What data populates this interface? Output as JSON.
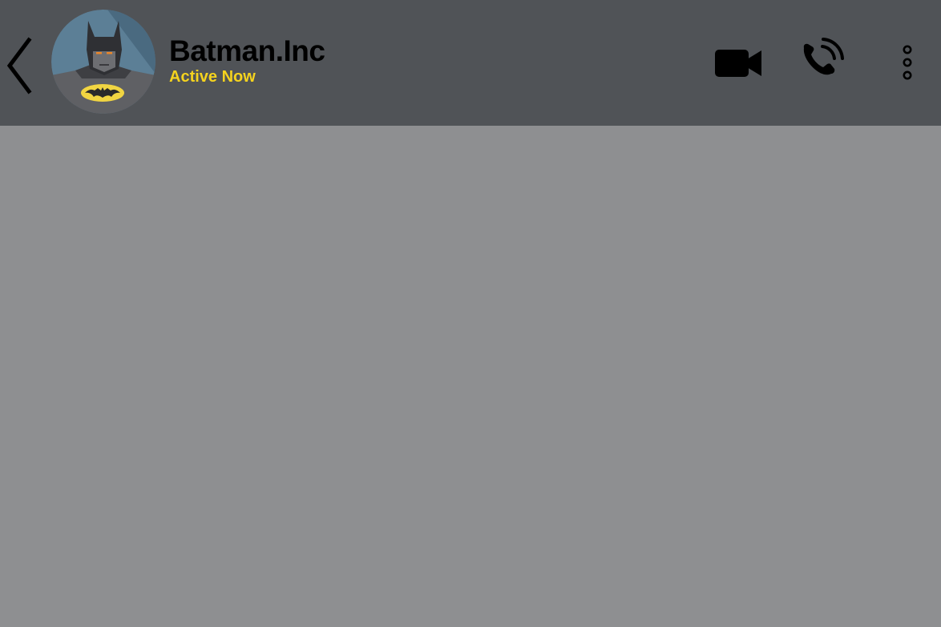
{
  "header": {
    "back_icon": "chevron-left-icon",
    "avatar_icon": "batman-avatar",
    "contact_name": "Batman.Inc",
    "status": "Active Now",
    "actions": {
      "video_icon": "video-camera-icon",
      "call_icon": "phone-call-icon",
      "menu_icon": "more-vertical-icon"
    }
  },
  "chat": {
    "messages": []
  },
  "colors": {
    "header_bg": "#505357",
    "chat_bg": "#8e8f91",
    "status_color": "#f5d31e",
    "icon_color": "#000000"
  }
}
